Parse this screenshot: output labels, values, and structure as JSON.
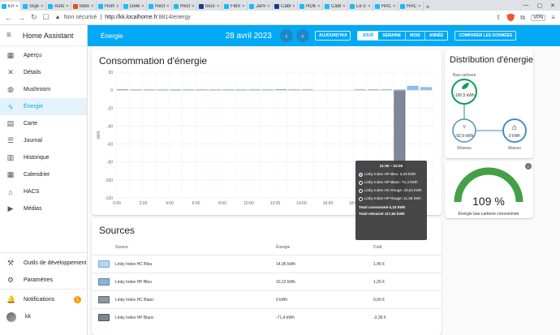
{
  "browser": {
    "tabs": [
      {
        "label": "Én",
        "color": "#18bcf2",
        "active": true
      },
      {
        "label": "Sujet",
        "color": "#18bcf2"
      },
      {
        "label": "Autom",
        "color": "#18bcf2"
      },
      {
        "label": "lebon",
        "color": "#e84c1f"
      },
      {
        "label": "Home",
        "color": "#18bcf2"
      },
      {
        "label": "Delet",
        "color": "#18bcf2"
      },
      {
        "label": "Reche",
        "color": "#18bcf2"
      },
      {
        "label": "Reche",
        "color": "#18bcf2"
      },
      {
        "label": "tousk",
        "color": "#1a3a8f"
      },
      {
        "label": "Fibre",
        "color": "#18bcf2"
      },
      {
        "label": "Jarret",
        "color": "#18bcf2"
      },
      {
        "label": "Câble",
        "color": "#1a3a8f"
      },
      {
        "label": "HDMI",
        "color": "#18bcf2"
      },
      {
        "label": "Câble",
        "color": "#18bcf2"
      },
      {
        "label": "Le sui",
        "color": "#18bcf2"
      },
      {
        "label": "HACF",
        "color": "#18bcf2"
      },
      {
        "label": "HACF",
        "color": "#18bcf2"
      }
    ],
    "security": "Non sécurisé",
    "url_host": "http://kk.localhome.fr",
    "url_rest": ":8814/energy",
    "vpn": "VPN"
  },
  "sidebar": {
    "title": "Home Assistant",
    "items": [
      {
        "label": "Aperçu",
        "icon": "▦"
      },
      {
        "label": "Détails",
        "icon": "✕"
      },
      {
        "label": "Mushroom",
        "icon": "◍"
      },
      {
        "label": "Énergie",
        "icon": "ϟ",
        "active": true
      },
      {
        "label": "Carte",
        "icon": "▤"
      },
      {
        "label": "Journal",
        "icon": "☰"
      },
      {
        "label": "Historique",
        "icon": "▥"
      },
      {
        "label": "Calendrier",
        "icon": "▦"
      },
      {
        "label": "HACS",
        "icon": "⌂"
      },
      {
        "label": "Médias",
        "icon": "▶"
      }
    ],
    "bottom": [
      {
        "label": "Outils de développement",
        "icon": "⚒"
      },
      {
        "label": "Paramètres",
        "icon": "⚙"
      },
      {
        "label": "Notifications",
        "icon": "🔔",
        "badge": "1"
      },
      {
        "label": "kk",
        "icon": "avatar"
      }
    ]
  },
  "header": {
    "title": "Énergie",
    "date": "28 avril 2023",
    "today_label": "AUJOURD'HUI",
    "periods": [
      "JOUR",
      "SEMAINE",
      "MOIS",
      "ANNÉE"
    ],
    "selected_period": "JOUR",
    "compare_label": "COMPARER LES DONNÉES"
  },
  "consumption": {
    "title": "Consommation d'énergie"
  },
  "chart_data": {
    "type": "bar",
    "ylabel": "kWh",
    "ylim": [
      -120,
      20
    ],
    "yticks": [
      "20",
      "0",
      "-20",
      "-40",
      "-60",
      "-80",
      "-100",
      "-120"
    ],
    "xticks": [
      "0:00",
      "2:00",
      "4:00",
      "6:00",
      "8:00",
      "10:00",
      "12:00",
      "14:00",
      "16:00",
      "18:00",
      "20:00",
      "22:00"
    ],
    "hours": [
      0,
      1,
      2,
      3,
      4,
      5,
      6,
      7,
      8,
      9,
      10,
      11,
      12,
      13,
      14,
      15,
      16,
      17,
      18,
      19,
      20,
      21,
      22,
      23
    ],
    "consumed": [
      0.8,
      0.5,
      0.5,
      0.5,
      0.5,
      0.5,
      0.5,
      0.5,
      0.5,
      0.5,
      0.5,
      0.5,
      0.8,
      0.5,
      0.5,
      0,
      0,
      0,
      0.6,
      0.6,
      0.6,
      0.33,
      4.5,
      3.0
    ],
    "returned": [
      0,
      0,
      0,
      0,
      0,
      0,
      0,
      0,
      0,
      0,
      0,
      0,
      0,
      0,
      0,
      0,
      0,
      0,
      0,
      0,
      0,
      117.64,
      0,
      0
    ],
    "bar_color": "#8ec3e8",
    "return_color": "#7f8899"
  },
  "tooltip": {
    "header": "21:00 – 22:00",
    "items": [
      {
        "text": "Linky Index HP Bleu: 0,33 kWh",
        "color": "#5c8fbd"
      },
      {
        "text": "Linky Index HP Blanc: 71,4 kWh",
        "color": "#444c5a"
      },
      {
        "text": "Linky Index HC Rouge: 34,84 kWh",
        "color": "#444c5a"
      },
      {
        "text": "Linky Index HP Rouge: 11,39 kWh",
        "color": "#333"
      }
    ],
    "total_consumed": "Total consommé 0,33 kWh",
    "total_returned": "Total retourné 117,64 kWh"
  },
  "sources": {
    "title": "Sources",
    "headers": {
      "source": "Source",
      "energy": "Énergie",
      "cost": "Coût"
    },
    "rows": [
      {
        "name": "Linky Index HC Bleu",
        "energy": "14,95 kWh",
        "cost": "1,45 €",
        "fill": "#b7d7ef",
        "border": "#6fa8d6"
      },
      {
        "name": "Linky Index HP Bleu",
        "energy": "10,12 kWh",
        "cost": "1,26 €",
        "fill": "#8eb3cf",
        "border": "#4f87b3"
      },
      {
        "name": "Linky Index HC Blanc",
        "energy": "0 kWh",
        "cost": "0,00 €",
        "fill": "#8d98a7",
        "border": "#5d6876"
      },
      {
        "name": "Linky Index HP Blanc",
        "energy": "-71,4 kWh",
        "cost": "-3,39 €",
        "fill": "#7b8593",
        "border": "#4a5260"
      }
    ]
  },
  "distribution": {
    "title": "Distribution d'énergie",
    "low_carbon_label": "Bas-carbone",
    "low_carbon_value": "-100,5 kWh",
    "grid_value": "-92,9 kWh",
    "grid_label": "Réseau",
    "home_value": "0 kWh",
    "home_label": "Maison",
    "green": "#0f9d58",
    "grid_blue": "#488fc2"
  },
  "gauge": {
    "value_text": "109 %",
    "value_fraction": 1.0,
    "label": "Énergie bas-carbone consommée",
    "color": "#43a047"
  }
}
